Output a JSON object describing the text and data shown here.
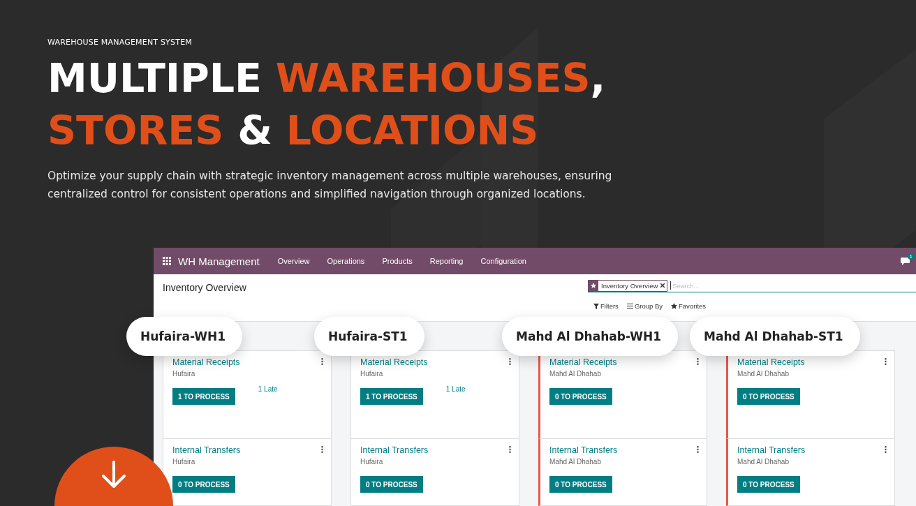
{
  "hero": {
    "eyebrow": "WAREHOUSE MANAGEMENT SYSTEM",
    "headline": [
      [
        {
          "text": "MULTIPLE ",
          "highlight": false
        },
        {
          "text": "WAREHOUSES",
          "highlight": true
        },
        {
          "text": ",",
          "highlight": false
        }
      ],
      [
        {
          "text": "STORES ",
          "highlight": true
        },
        {
          "text": "& ",
          "highlight": false
        },
        {
          "text": "LOCATIONS",
          "highlight": true
        }
      ]
    ],
    "description": "Optimize your supply chain with strategic inventory management across multiple warehouses, ensuring centralized control for consistent operations and simplified navigation through organized locations."
  },
  "app": {
    "brand": "WH Management",
    "menu": [
      "Overview",
      "Operations",
      "Products",
      "Reporting",
      "Configuration"
    ],
    "notification_count": "1",
    "breadcrumb": "Inventory Overview",
    "search": {
      "facet": "Inventory Overview",
      "placeholder": "Search..."
    },
    "search_options": [
      {
        "kind": "filter",
        "label": "Filters"
      },
      {
        "kind": "group",
        "label": "Group By"
      },
      {
        "kind": "favorite",
        "label": "Favorites"
      }
    ],
    "warehouses": [
      {
        "name": "Hufaira-WH1",
        "flagged": false,
        "cards": [
          {
            "title": "Material Receipts",
            "location": "Hufaira",
            "action": "1 TO PROCESS",
            "late": "1 Late"
          },
          {
            "title": "Internal Transfers",
            "location": "Hufaira",
            "action": "0 TO PROCESS"
          }
        ]
      },
      {
        "name": "Hufaira-ST1",
        "flagged": false,
        "cards": [
          {
            "title": "Material Receipts",
            "location": "Hufaira",
            "action": "1 TO PROCESS",
            "late": "1 Late"
          },
          {
            "title": "Internal Transfers",
            "location": "Hufaira",
            "action": "0 TO PROCESS"
          }
        ]
      },
      {
        "name": "Mahd Al Dhahab-WH1",
        "flagged": true,
        "cards": [
          {
            "title": "Material Receipts",
            "location": "Mahd Al Dhahab",
            "action": "0 TO PROCESS"
          },
          {
            "title": "Internal Transfers",
            "location": "Mahd Al Dhahab",
            "action": "0 TO PROCESS"
          }
        ]
      },
      {
        "name": "Mahd Al Dhahab-ST1",
        "flagged": true,
        "cards": [
          {
            "title": "Material Receipts",
            "location": "Mahd Al Dhahab",
            "action": "0 TO PROCESS"
          },
          {
            "title": "Internal Transfers",
            "location": "Mahd Al Dhahab",
            "action": "0 TO PROCESS"
          }
        ]
      }
    ]
  }
}
